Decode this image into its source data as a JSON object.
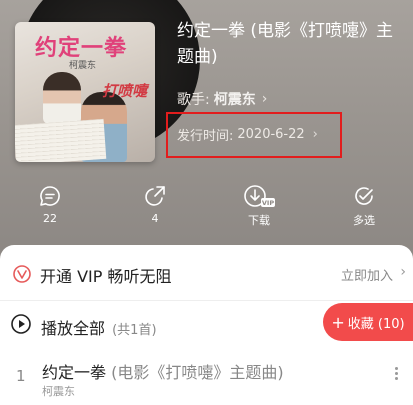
{
  "album": {
    "cover_title_art": "约定一拳",
    "cover_artist_art": "柯震东",
    "cover_film_logo": "打喷嚏"
  },
  "song": {
    "title": "约定一拳 (电影《打喷嚏》主题曲)",
    "singer_label": "歌手:",
    "singer_name": "柯震东",
    "release_label": "发行时间:",
    "release_date": "2020-6-22"
  },
  "actions": {
    "comment_count": "22",
    "share_count": "4",
    "download_label": "下载",
    "vip_badge": "VIP",
    "multiselect_label": "多选"
  },
  "vip": {
    "text": "开通 VIP 畅听无阻",
    "join_label": "立即加入"
  },
  "playlist": {
    "play_all_label": "播放全部",
    "count_text": "(共1首)",
    "collect_label": "收藏 (10)",
    "tracks": [
      {
        "index": "1",
        "title": "约定一拳",
        "subtitle": " (电影《打喷嚏》主题曲)",
        "artist": "柯震东"
      }
    ]
  },
  "colors": {
    "accent": "#f24b4b",
    "highlight": "#e21d1d"
  }
}
